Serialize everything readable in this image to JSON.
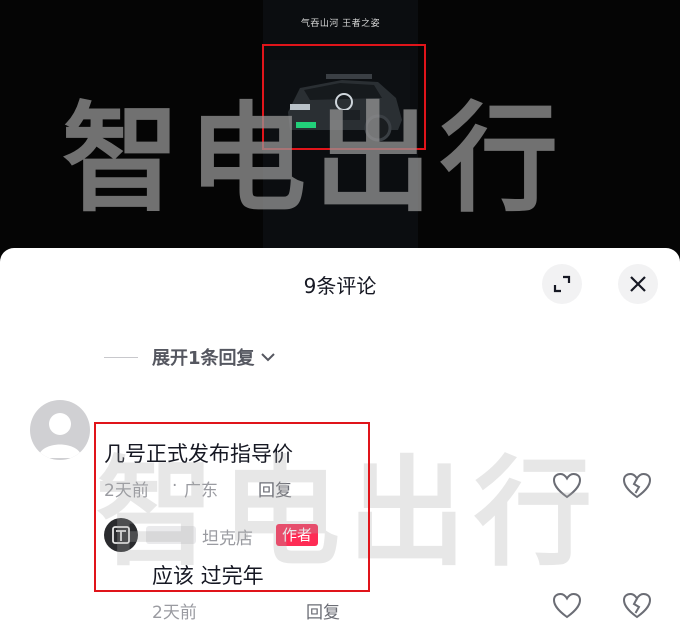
{
  "video": {
    "caption": "气吞山河 王者之姿"
  },
  "watermark": {
    "text": "智电出行"
  },
  "sheet": {
    "title": "9条评论",
    "expand_label": "展开1条回复"
  },
  "comment": {
    "text": "几号正式发布指导价",
    "time": "2天前",
    "separator": "·",
    "location": "广东",
    "reply_label": "回复"
  },
  "reply": {
    "author": "坦克店",
    "author_tag": "作者",
    "text": "应该  过完年",
    "time": "2天前",
    "reply_label": "回复"
  },
  "colors": {
    "accent": "#fe2c55",
    "highlight_box": "#e0141a"
  }
}
